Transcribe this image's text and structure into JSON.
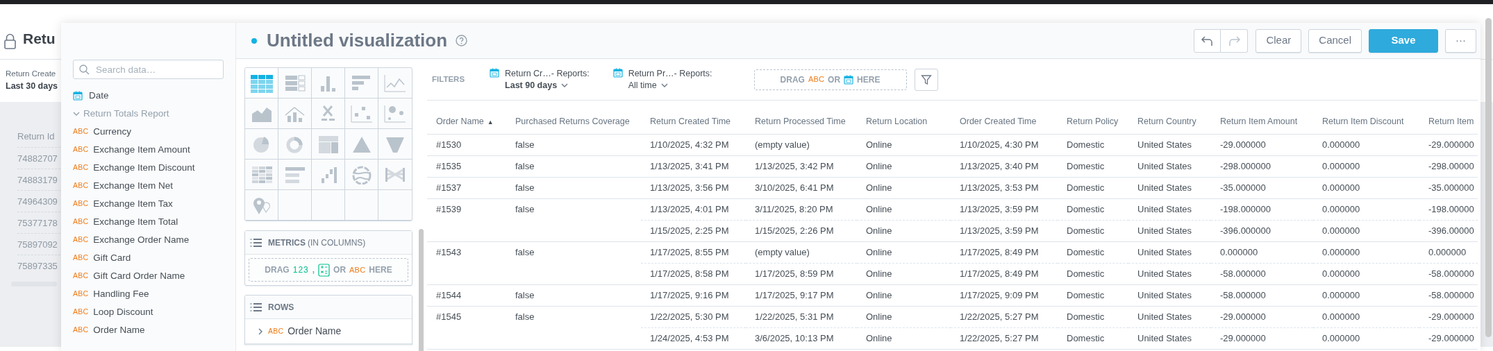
{
  "background_dashboard": {
    "title": "Retu",
    "filter": {
      "label": "Return Create",
      "value": "Last 30 days"
    },
    "table": {
      "column": "Return Id",
      "rows": [
        "74882707",
        "74883179",
        "74964309",
        "75377178",
        "75897092",
        "75897335"
      ]
    }
  },
  "data_panel": {
    "search": {
      "placeholder": "Search data…"
    },
    "date_item": {
      "label": "Date"
    },
    "dataset": {
      "name": "Return Totals Report",
      "expanded": true,
      "items": [
        {
          "type_label": "ABC",
          "label": "Currency"
        },
        {
          "type_label": "ABC",
          "label": "Exchange Item Amount"
        },
        {
          "type_label": "ABC",
          "label": "Exchange Item Discount"
        },
        {
          "type_label": "ABC",
          "label": "Exchange Item Net"
        },
        {
          "type_label": "ABC",
          "label": "Exchange Item Tax"
        },
        {
          "type_label": "ABC",
          "label": "Exchange Item Total"
        },
        {
          "type_label": "ABC",
          "label": "Exchange Order Name"
        },
        {
          "type_label": "ABC",
          "label": "Gift Card"
        },
        {
          "type_label": "ABC",
          "label": "Gift Card Order Name"
        },
        {
          "type_label": "ABC",
          "label": "Handling Fee"
        },
        {
          "type_label": "ABC",
          "label": "Loop Discount"
        },
        {
          "type_label": "ABC",
          "label": "Order Name"
        }
      ]
    }
  },
  "header": {
    "title": "Untitled visualization",
    "undo": {
      "disabled": false
    },
    "redo": {
      "disabled": true
    },
    "buttons": [
      {
        "label": "Clear",
        "kind": "default"
      },
      {
        "label": "Cancel",
        "kind": "default"
      },
      {
        "label": "Save",
        "kind": "primary"
      },
      {
        "label": "···",
        "kind": "default"
      }
    ]
  },
  "visualization_types": [
    {
      "kind": "table",
      "selected": true
    },
    {
      "kind": "repeater",
      "selected": false
    },
    {
      "kind": "column",
      "selected": false
    },
    {
      "kind": "bar",
      "selected": false
    },
    {
      "kind": "line",
      "selected": false
    },
    {
      "kind": "area",
      "selected": false
    },
    {
      "kind": "combo",
      "selected": false
    },
    {
      "kind": "headline",
      "selected": false
    },
    {
      "kind": "scatter",
      "selected": false
    },
    {
      "kind": "bubble",
      "selected": false
    },
    {
      "kind": "pie",
      "selected": false
    },
    {
      "kind": "donut",
      "selected": false
    },
    {
      "kind": "treemap",
      "selected": false
    },
    {
      "kind": "pyramid",
      "selected": false
    },
    {
      "kind": "funnel",
      "selected": false
    },
    {
      "kind": "heatmap",
      "selected": false
    },
    {
      "kind": "bullet",
      "selected": false
    },
    {
      "kind": "waterfall",
      "selected": false
    },
    {
      "kind": "wheel",
      "selected": false
    },
    {
      "kind": "sankey",
      "selected": false
    },
    {
      "kind": "pushpin",
      "selected": false
    }
  ],
  "buckets": {
    "metrics": {
      "title": "METRICS",
      "subtitle": "(IN COLUMNS)",
      "drop_zone": [
        {
          "kind": "word",
          "text": "DRAG"
        },
        {
          "kind": "numeric",
          "text": "123"
        },
        {
          "kind": "word",
          "text": ","
        },
        {
          "kind": "calc-icon"
        },
        {
          "kind": "word",
          "text": "OR"
        },
        {
          "kind": "attribute",
          "text": "ABC"
        },
        {
          "kind": "word",
          "text": "HERE"
        }
      ]
    },
    "rows": {
      "title": "ROWS",
      "items": [
        {
          "type_label": "ABC",
          "label": "Order Name"
        }
      ]
    }
  },
  "filters": {
    "label": "FILTERS",
    "items": [
      {
        "label": "Return Cr…- Reports:",
        "value": "Last 90 days",
        "active": true
      },
      {
        "label": "Return Pr…- Reports:",
        "value": "All time",
        "active": false
      }
    ],
    "drop_zone": [
      {
        "kind": "word",
        "text": "DRAG"
      },
      {
        "kind": "attribute",
        "text": "ABC"
      },
      {
        "kind": "word",
        "text": "OR"
      },
      {
        "kind": "date-icon"
      },
      {
        "kind": "word",
        "text": "HERE"
      }
    ]
  },
  "table": {
    "columns": [
      {
        "label": "Order Name",
        "sort_indicator": "▲"
      },
      {
        "label": "Purchased Returns Coverage"
      },
      {
        "label": "Return Created Time"
      },
      {
        "label": "Return Processed Time"
      },
      {
        "label": "Return Location"
      },
      {
        "label": "Order Created Time"
      },
      {
        "label": "Return Policy"
      },
      {
        "label": "Return Country"
      },
      {
        "label": "Return Item Amount"
      },
      {
        "label": "Return Item Discount"
      },
      {
        "label": "Return Item"
      }
    ],
    "groups": [
      {
        "order_name": "#1530",
        "coverage": "false",
        "returns": [
          [
            "1/10/2025, 4:32 PM",
            "(empty value)",
            "Online",
            "1/10/2025, 4:30 PM",
            "Domestic",
            "United States",
            "-29.000000",
            "0.000000",
            "-29.000000"
          ]
        ]
      },
      {
        "order_name": "#1535",
        "coverage": "false",
        "returns": [
          [
            "1/13/2025, 3:41 PM",
            "1/13/2025, 3:42 PM",
            "Online",
            "1/13/2025, 3:40 PM",
            "Domestic",
            "United States",
            "-298.000000",
            "0.000000",
            "-298.00000"
          ]
        ]
      },
      {
        "order_name": "#1537",
        "coverage": "false",
        "returns": [
          [
            "1/13/2025, 3:56 PM",
            "3/10/2025, 6:41 PM",
            "Online",
            "1/13/2025, 3:53 PM",
            "Domestic",
            "United States",
            "-35.000000",
            "0.000000",
            "-35.000000"
          ]
        ]
      },
      {
        "order_name": "#1539",
        "coverage": "false",
        "returns": [
          [
            "1/13/2025, 4:01 PM",
            "3/11/2025, 8:20 PM",
            "Online",
            "1/13/2025, 3:59 PM",
            "Domestic",
            "United States",
            "-198.000000",
            "0.000000",
            "-198.00000"
          ],
          [
            "1/15/2025, 2:25 PM",
            "1/15/2025, 2:26 PM",
            "Online",
            "1/13/2025, 3:59 PM",
            "Domestic",
            "United States",
            "-396.000000",
            "0.000000",
            "-396.00000"
          ]
        ]
      },
      {
        "order_name": "#1543",
        "coverage": "false",
        "returns": [
          [
            "1/17/2025, 8:55 PM",
            "(empty value)",
            "Online",
            "1/17/2025, 8:49 PM",
            "Domestic",
            "United States",
            "0.000000",
            "0.000000",
            "0.000000"
          ],
          [
            "1/17/2025, 8:58 PM",
            "1/17/2025, 8:59 PM",
            "Online",
            "1/17/2025, 8:49 PM",
            "Domestic",
            "United States",
            "-58.000000",
            "0.000000",
            "-58.000000"
          ]
        ]
      },
      {
        "order_name": "#1544",
        "coverage": "false",
        "returns": [
          [
            "1/17/2025, 9:16 PM",
            "1/17/2025, 9:17 PM",
            "Online",
            "1/17/2025, 9:09 PM",
            "Domestic",
            "United States",
            "-58.000000",
            "0.000000",
            "-58.000000"
          ]
        ]
      },
      {
        "order_name": "#1545",
        "coverage": "false",
        "returns": [
          [
            "1/22/2025, 5:30 PM",
            "1/22/2025, 5:31 PM",
            "Online",
            "1/22/2025, 5:27 PM",
            "Domestic",
            "United States",
            "-29.000000",
            "0.000000",
            "-29.000000"
          ],
          [
            "1/24/2025, 4:53 PM",
            "3/6/2025, 10:13 PM",
            "Online",
            "1/22/2025, 5:27 PM",
            "Domestic",
            "United States",
            "-29.000000",
            "0.000000",
            "-29.000000"
          ]
        ]
      }
    ]
  }
}
